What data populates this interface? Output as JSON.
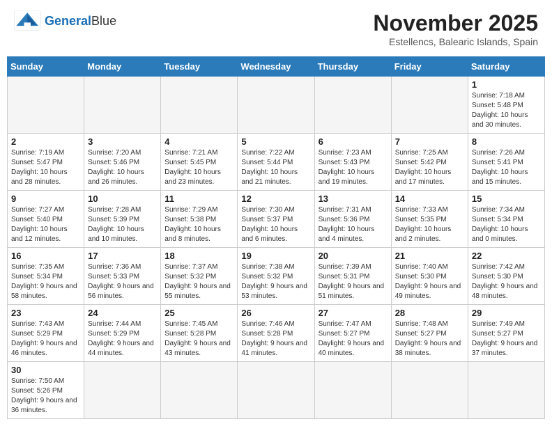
{
  "header": {
    "logo_general": "General",
    "logo_blue": "Blue",
    "month_title": "November 2025",
    "location": "Estellencs, Balearic Islands, Spain"
  },
  "days_of_week": [
    "Sunday",
    "Monday",
    "Tuesday",
    "Wednesday",
    "Thursday",
    "Friday",
    "Saturday"
  ],
  "weeks": [
    [
      {
        "day": "",
        "info": ""
      },
      {
        "day": "",
        "info": ""
      },
      {
        "day": "",
        "info": ""
      },
      {
        "day": "",
        "info": ""
      },
      {
        "day": "",
        "info": ""
      },
      {
        "day": "",
        "info": ""
      },
      {
        "day": "1",
        "info": "Sunrise: 7:18 AM\nSunset: 5:48 PM\nDaylight: 10 hours and 30 minutes."
      }
    ],
    [
      {
        "day": "2",
        "info": "Sunrise: 7:19 AM\nSunset: 5:47 PM\nDaylight: 10 hours and 28 minutes."
      },
      {
        "day": "3",
        "info": "Sunrise: 7:20 AM\nSunset: 5:46 PM\nDaylight: 10 hours and 26 minutes."
      },
      {
        "day": "4",
        "info": "Sunrise: 7:21 AM\nSunset: 5:45 PM\nDaylight: 10 hours and 23 minutes."
      },
      {
        "day": "5",
        "info": "Sunrise: 7:22 AM\nSunset: 5:44 PM\nDaylight: 10 hours and 21 minutes."
      },
      {
        "day": "6",
        "info": "Sunrise: 7:23 AM\nSunset: 5:43 PM\nDaylight: 10 hours and 19 minutes."
      },
      {
        "day": "7",
        "info": "Sunrise: 7:25 AM\nSunset: 5:42 PM\nDaylight: 10 hours and 17 minutes."
      },
      {
        "day": "8",
        "info": "Sunrise: 7:26 AM\nSunset: 5:41 PM\nDaylight: 10 hours and 15 minutes."
      }
    ],
    [
      {
        "day": "9",
        "info": "Sunrise: 7:27 AM\nSunset: 5:40 PM\nDaylight: 10 hours and 12 minutes."
      },
      {
        "day": "10",
        "info": "Sunrise: 7:28 AM\nSunset: 5:39 PM\nDaylight: 10 hours and 10 minutes."
      },
      {
        "day": "11",
        "info": "Sunrise: 7:29 AM\nSunset: 5:38 PM\nDaylight: 10 hours and 8 minutes."
      },
      {
        "day": "12",
        "info": "Sunrise: 7:30 AM\nSunset: 5:37 PM\nDaylight: 10 hours and 6 minutes."
      },
      {
        "day": "13",
        "info": "Sunrise: 7:31 AM\nSunset: 5:36 PM\nDaylight: 10 hours and 4 minutes."
      },
      {
        "day": "14",
        "info": "Sunrise: 7:33 AM\nSunset: 5:35 PM\nDaylight: 10 hours and 2 minutes."
      },
      {
        "day": "15",
        "info": "Sunrise: 7:34 AM\nSunset: 5:34 PM\nDaylight: 10 hours and 0 minutes."
      }
    ],
    [
      {
        "day": "16",
        "info": "Sunrise: 7:35 AM\nSunset: 5:34 PM\nDaylight: 9 hours and 58 minutes."
      },
      {
        "day": "17",
        "info": "Sunrise: 7:36 AM\nSunset: 5:33 PM\nDaylight: 9 hours and 56 minutes."
      },
      {
        "day": "18",
        "info": "Sunrise: 7:37 AM\nSunset: 5:32 PM\nDaylight: 9 hours and 55 minutes."
      },
      {
        "day": "19",
        "info": "Sunrise: 7:38 AM\nSunset: 5:32 PM\nDaylight: 9 hours and 53 minutes."
      },
      {
        "day": "20",
        "info": "Sunrise: 7:39 AM\nSunset: 5:31 PM\nDaylight: 9 hours and 51 minutes."
      },
      {
        "day": "21",
        "info": "Sunrise: 7:40 AM\nSunset: 5:30 PM\nDaylight: 9 hours and 49 minutes."
      },
      {
        "day": "22",
        "info": "Sunrise: 7:42 AM\nSunset: 5:30 PM\nDaylight: 9 hours and 48 minutes."
      }
    ],
    [
      {
        "day": "23",
        "info": "Sunrise: 7:43 AM\nSunset: 5:29 PM\nDaylight: 9 hours and 46 minutes."
      },
      {
        "day": "24",
        "info": "Sunrise: 7:44 AM\nSunset: 5:29 PM\nDaylight: 9 hours and 44 minutes."
      },
      {
        "day": "25",
        "info": "Sunrise: 7:45 AM\nSunset: 5:28 PM\nDaylight: 9 hours and 43 minutes."
      },
      {
        "day": "26",
        "info": "Sunrise: 7:46 AM\nSunset: 5:28 PM\nDaylight: 9 hours and 41 minutes."
      },
      {
        "day": "27",
        "info": "Sunrise: 7:47 AM\nSunset: 5:27 PM\nDaylight: 9 hours and 40 minutes."
      },
      {
        "day": "28",
        "info": "Sunrise: 7:48 AM\nSunset: 5:27 PM\nDaylight: 9 hours and 38 minutes."
      },
      {
        "day": "29",
        "info": "Sunrise: 7:49 AM\nSunset: 5:27 PM\nDaylight: 9 hours and 37 minutes."
      }
    ],
    [
      {
        "day": "30",
        "info": "Sunrise: 7:50 AM\nSunset: 5:26 PM\nDaylight: 9 hours and 36 minutes."
      },
      {
        "day": "",
        "info": ""
      },
      {
        "day": "",
        "info": ""
      },
      {
        "day": "",
        "info": ""
      },
      {
        "day": "",
        "info": ""
      },
      {
        "day": "",
        "info": ""
      },
      {
        "day": "",
        "info": ""
      }
    ]
  ]
}
